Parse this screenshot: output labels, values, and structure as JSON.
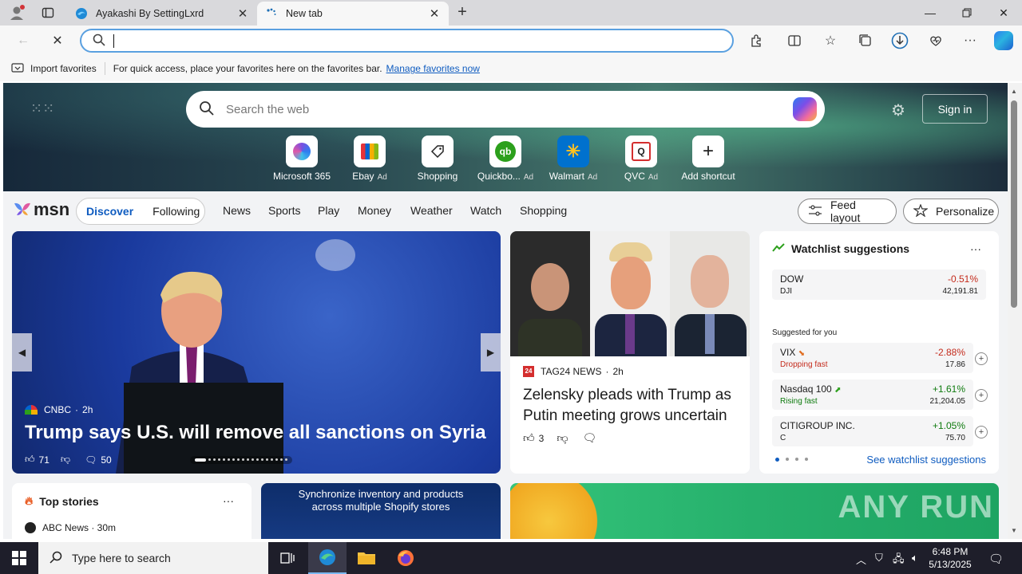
{
  "browser": {
    "tabs": [
      {
        "title": "Ayakashi By SettingLxrd"
      },
      {
        "title": "New tab"
      }
    ],
    "address_value": "",
    "favorites_bar": {
      "import_label": "Import favorites",
      "message": "For quick access, place your favorites here on the favorites bar.",
      "manage_link": "Manage favorites now"
    }
  },
  "newtab": {
    "search_placeholder": "Search the web",
    "sign_in": "Sign in",
    "shortcuts": [
      {
        "label": "Microsoft 365",
        "ad": ""
      },
      {
        "label": "Ebay",
        "ad": "Ad"
      },
      {
        "label": "Shopping",
        "ad": ""
      },
      {
        "label": "Quickbo...",
        "ad": "Ad"
      },
      {
        "label": "Walmart",
        "ad": "Ad"
      },
      {
        "label": "QVC",
        "ad": "Ad"
      },
      {
        "label": "Add shortcut",
        "ad": ""
      }
    ]
  },
  "msn": {
    "logo": "msn",
    "pill_tabs": [
      "Discover",
      "Following"
    ],
    "nav": [
      "News",
      "Sports",
      "Play",
      "Money",
      "Weather",
      "Watch",
      "Shopping"
    ],
    "feed_layout": "Feed layout",
    "personalize": "Personalize"
  },
  "carousel": {
    "source": "CNBC",
    "age": "2h",
    "headline": "Trump says U.S. will remove all sanctions on Syria",
    "likes": "71",
    "comments": "50"
  },
  "story2": {
    "source": "TAG24 NEWS",
    "age": "2h",
    "headline": "Zelensky pleads with Trump as Putin meeting grows uncertain",
    "likes": "3"
  },
  "watchlist": {
    "title": "Watchlist suggestions",
    "suggested_label": "Suggested for you",
    "see_more": "See watchlist suggestions",
    "items": [
      {
        "name": "DOW",
        "sub": "DJI",
        "change": "-0.51%",
        "value": "42,191.81",
        "color": "#c42b1c"
      },
      {
        "name": "VIX",
        "sub": "Dropping fast",
        "change": "-2.88%",
        "value": "17.86",
        "color": "#c42b1c"
      },
      {
        "name": "Nasdaq 100",
        "sub": "Rising fast",
        "change": "+1.61%",
        "value": "21,204.05",
        "color": "#0f7b0f"
      },
      {
        "name": "CITIGROUP INC.",
        "sub": "C",
        "change": "+1.05%",
        "value": "75.70",
        "color": "#0f7b0f"
      }
    ]
  },
  "bottom": {
    "top_stories": "Top stories",
    "top_story_source": "ABC News · 30m",
    "shopify_ad": "Synchronize inventory and products across multiple Shopify stores",
    "watermark": "ANY RUN"
  },
  "taskbar": {
    "search_placeholder": "Type here to search",
    "time": "6:48 PM",
    "date": "5/13/2025"
  }
}
